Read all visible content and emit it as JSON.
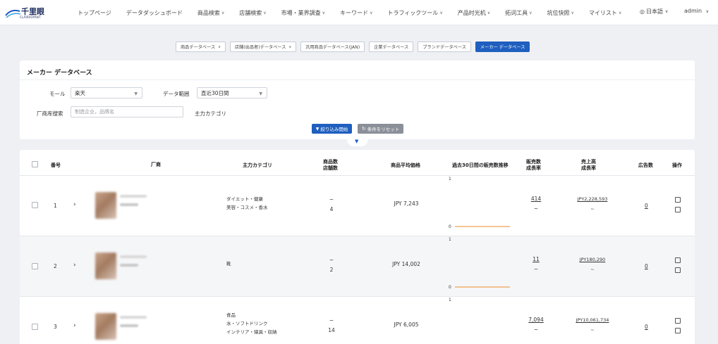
{
  "logo": {
    "name": "千里眼",
    "sub": "CLAIRVOYANT"
  },
  "nav": [
    {
      "label": "トップページ",
      "dropdown": false
    },
    {
      "label": "データダッシュボード",
      "dropdown": false
    },
    {
      "label": "商品検索",
      "dropdown": true
    },
    {
      "label": "店舗検索",
      "dropdown": true
    },
    {
      "label": "市場・業界調査",
      "dropdown": true
    },
    {
      "label": "キーワード",
      "dropdown": true
    },
    {
      "label": "トラフィックツール",
      "dropdown": true
    },
    {
      "label": "产品时光机",
      "dropdown": true
    },
    {
      "label": "拓词工具",
      "dropdown": true
    },
    {
      "label": "坑位快照",
      "dropdown": true
    },
    {
      "label": "マイリスト",
      "dropdown": true
    }
  ],
  "lang": "日本語",
  "user": "admin",
  "db_tabs": [
    {
      "label": "商品データベース",
      "dropdown": true,
      "active": false
    },
    {
      "label": "店舗(出品者)データベース",
      "dropdown": true,
      "active": false
    },
    {
      "label": "汎用商品データベース(JAN)",
      "dropdown": false,
      "active": false
    },
    {
      "label": "企業データベース",
      "dropdown": false,
      "active": false
    },
    {
      "label": "ブランドデータベース",
      "dropdown": false,
      "active": false
    },
    {
      "label": "メーカー データベース",
      "dropdown": false,
      "active": true
    }
  ],
  "filter": {
    "title": "メーカー データベース",
    "mall_label": "モール",
    "mall_value": "楽天",
    "range_label": "データ範囲",
    "range_value": "直近30日間",
    "maker_label": "厂商库搜索",
    "maker_placeholder": "制造企业，品牌名",
    "category_label": "主力カテゴリ",
    "search_button": "絞り込み開始",
    "reset_button": "条件をリセット"
  },
  "table": {
    "headers": {
      "no": "番号",
      "maker": "厂商",
      "category": "主力カテゴリ",
      "items_1": "商品数",
      "items_2": "店舗数",
      "avg_price": "商品平均価格",
      "trend": "過去30日間の販売数推移",
      "sales_1": "販売数",
      "sales_2": "成長率",
      "revenue_1": "売上高",
      "revenue_2": "成長率",
      "ads": "広告数",
      "ops": "操作"
    },
    "rows": [
      {
        "no": "1",
        "categories": [
          "ダイエット・健康",
          "美容・コスメ・香水"
        ],
        "items": "~",
        "shops": "4",
        "avg_price": "JPY 7,243",
        "spark_max": "1",
        "spark_min": "0",
        "sales": "414",
        "sales_growth": "~",
        "revenue": "JPY2,228,593",
        "revenue_growth": "~",
        "ads": "0"
      },
      {
        "no": "2",
        "categories": [
          "靴"
        ],
        "items": "~",
        "shops": "2",
        "avg_price": "JPY 14,002",
        "spark_max": "1",
        "spark_min": "0",
        "sales": "11",
        "sales_growth": "~",
        "revenue": "JPY180,290",
        "revenue_growth": "~",
        "ads": "0"
      },
      {
        "no": "3",
        "categories": [
          "食品",
          "水・ソフトドリンク",
          "インテリア・寝具・収納"
        ],
        "items": "~",
        "shops": "14",
        "avg_price": "JPY 6,005",
        "spark_max": "1",
        "spark_min": "",
        "sales": "7,094",
        "sales_growth": "~",
        "revenue": "JPY10,061,734",
        "revenue_growth": "~",
        "ads": "0"
      }
    ]
  },
  "colors": {
    "primary": "#1f5fbf",
    "spark": "#f0a050"
  }
}
